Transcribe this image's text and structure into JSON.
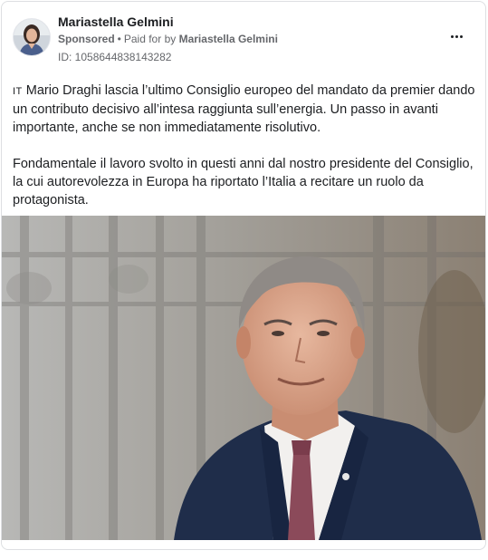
{
  "post": {
    "author": "Mariastella Gelmini",
    "sponsored": "Sponsored",
    "separator": "•",
    "paid_for_prefix": "Paid for by",
    "paid_for_name": "Mariastella Gelmini",
    "ad_id": "ID: 1058644838143282",
    "lang_tag": "IT",
    "paragraph1": "Mario Draghi lascia l’ultimo Consiglio europeo del mandato da premier dando un contributo decisivo all’intesa raggiunta sull’energia. Un passo in avanti importante, anche se non immediatamente risolutivo.",
    "paragraph2": "Fondamentale il lavoro svolto in questi anni dal nostro presidente del Consiglio, la cui autorevolezza in Europa ha riportato l’Italia a recitare un ruolo da protagonista.",
    "ellipsis": "..."
  },
  "icons": {
    "more": "more-horizontal-icon",
    "avatar": "profile-photo"
  },
  "colors": {
    "text_primary": "#1c1e21",
    "text_secondary": "#65676b",
    "border": "#dddfe2",
    "suit": "#1f2d4a",
    "tie": "#8b4a5a"
  }
}
